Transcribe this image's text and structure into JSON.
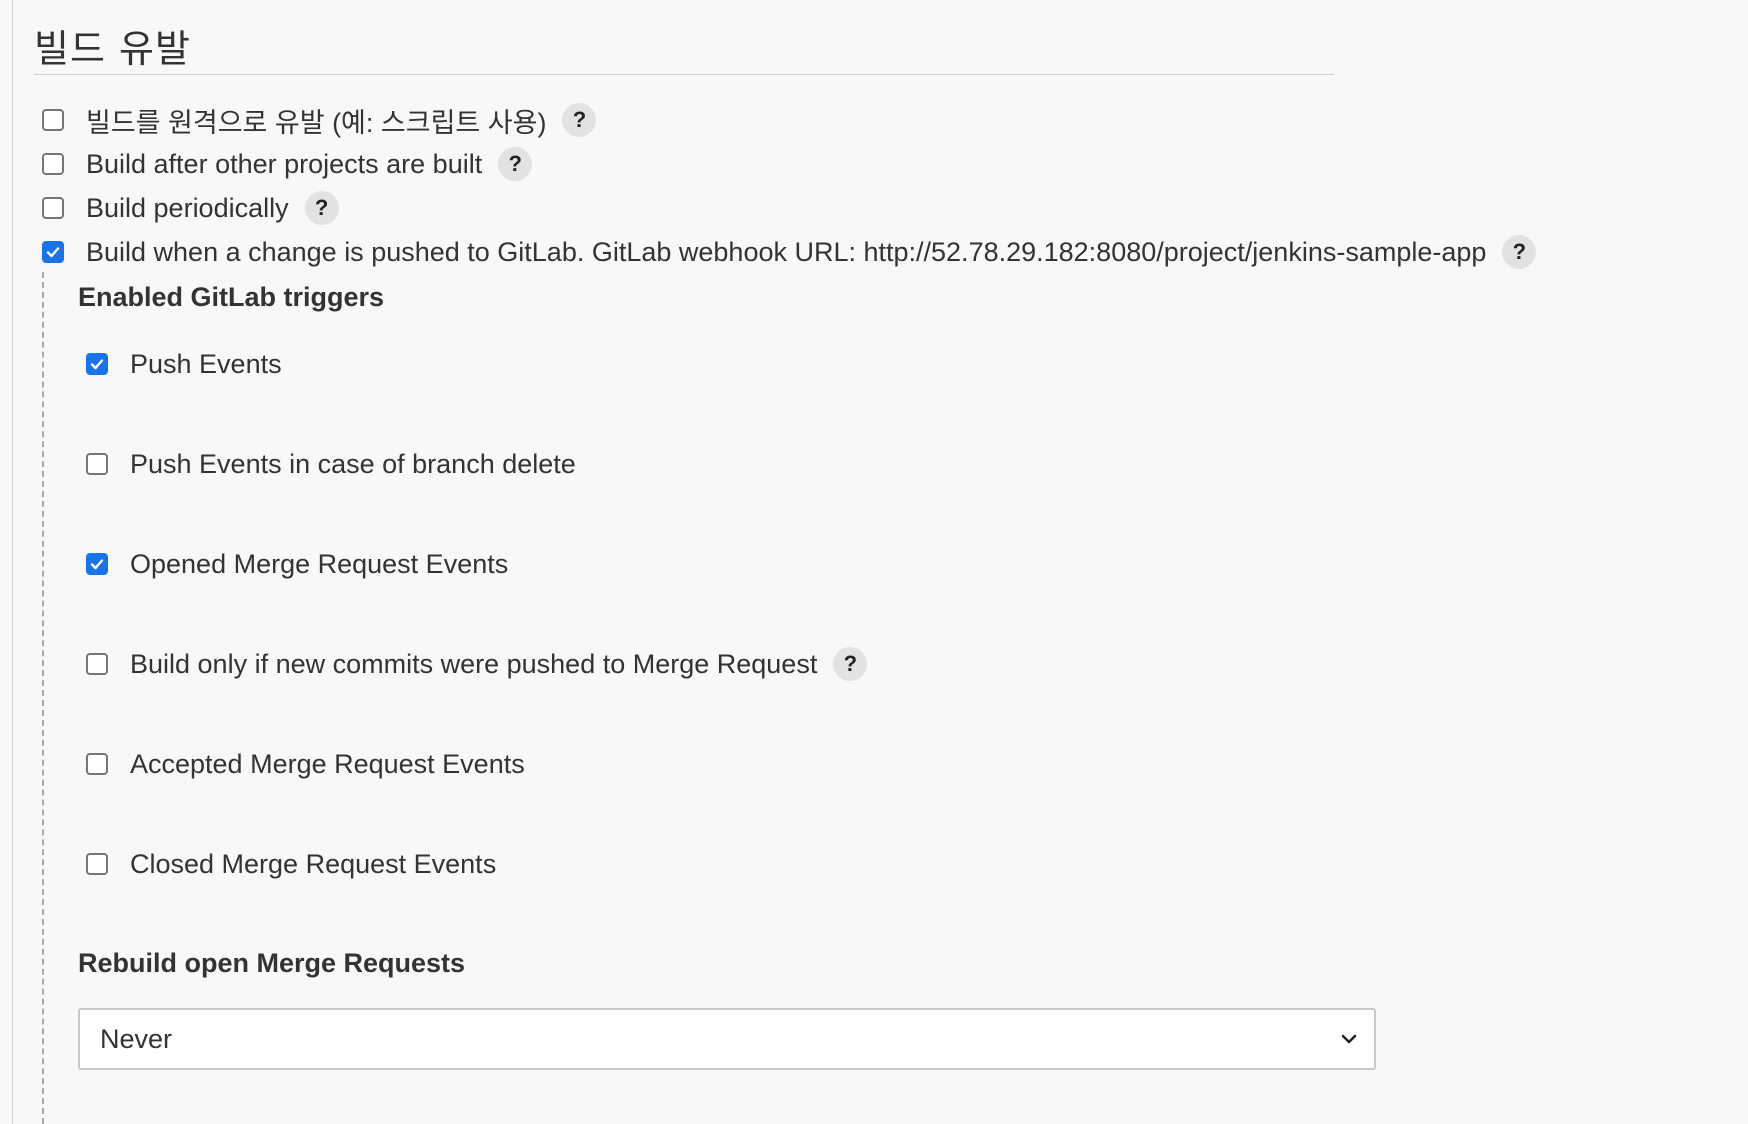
{
  "section": {
    "title": "빌드 유발"
  },
  "triggers": [
    {
      "label": "빌드를 원격으로 유발 (예: 스크립트 사용)",
      "checked": false,
      "help": "?"
    },
    {
      "label": "Build after other projects are built",
      "checked": false,
      "help": "?"
    },
    {
      "label": "Build periodically",
      "checked": false,
      "help": "?"
    },
    {
      "label": "Build when a change is pushed to GitLab. GitLab webhook URL: http://52.78.29.182:8080/project/jenkins-sample-app",
      "checked": true,
      "help": "?"
    }
  ],
  "gitlab": {
    "heading": "Enabled GitLab triggers",
    "events": [
      {
        "label": "Push Events",
        "checked": true
      },
      {
        "label": "Push Events in case of branch delete",
        "checked": false
      },
      {
        "label": "Opened Merge Request Events",
        "checked": true
      },
      {
        "label": "Build only if new commits were pushed to Merge Request",
        "checked": false,
        "help": "?"
      },
      {
        "label": "Accepted Merge Request Events",
        "checked": false
      },
      {
        "label": "Closed Merge Request Events",
        "checked": false
      }
    ],
    "rebuild": {
      "heading": "Rebuild open Merge Requests",
      "selected": "Never"
    }
  },
  "colors": {
    "checkbox_checked": "#1a73e8",
    "background": "#f8f8f8"
  },
  "icons": {
    "help": "question-mark-icon",
    "check": "checkmark-icon",
    "dropdown": "chevron-down-icon"
  }
}
